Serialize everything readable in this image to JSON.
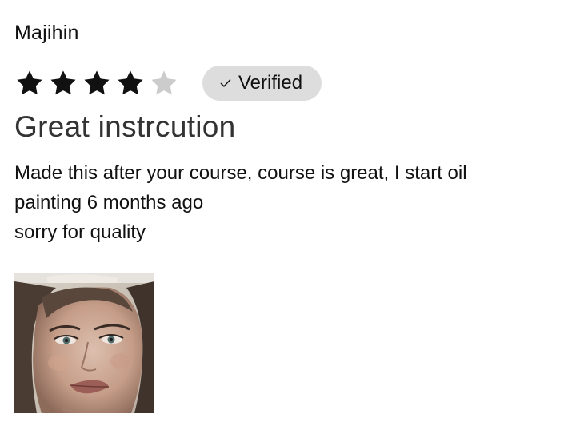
{
  "review": {
    "reviewer_name": "Majihin",
    "rating": 4,
    "max_rating": 5,
    "star_color_filled": "#111111",
    "star_color_empty": "#cccccc",
    "verified_label": "Verified",
    "verified_icon": "check-icon",
    "title": "Great instrcution",
    "body_lines": [
      "Made this after your course, course is great, I start oil",
      "painting 6 months ago",
      "sorry for quality"
    ],
    "attachments": [
      {
        "type": "image",
        "subject": "oil painting portrait"
      }
    ]
  }
}
